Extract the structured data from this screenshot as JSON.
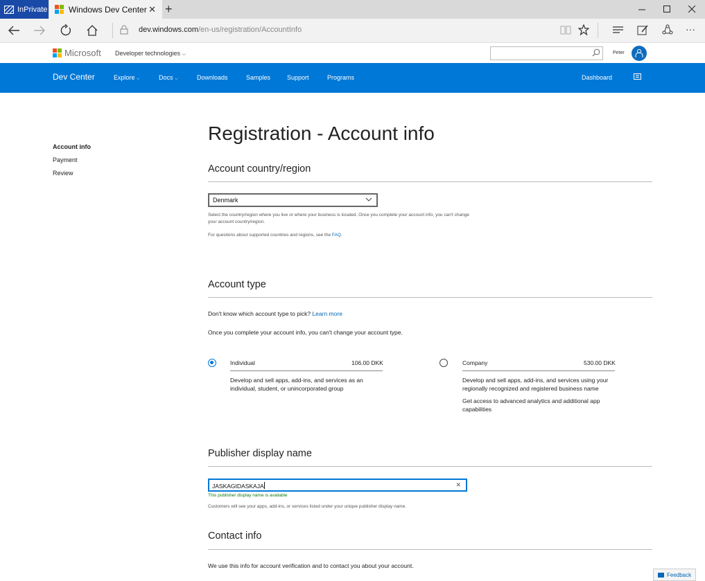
{
  "browser": {
    "inprivate_label": "InPrivate",
    "tab_title": "Windows Dev Center",
    "url_host": "dev.windows.com",
    "url_path": "/en-us/registration/AccountInfo"
  },
  "ms_header": {
    "logo_text": "Microsoft",
    "dev_tech": "Developer technologies",
    "search_value": "",
    "user_name": "Peter"
  },
  "nav": {
    "brand": "Dev Center",
    "items": [
      "Explore",
      "Docs",
      "Downloads",
      "Samples",
      "Support",
      "Programs"
    ],
    "dashboard": "Dashboard"
  },
  "side_nav": [
    "Account info",
    "Payment",
    "Review"
  ],
  "page": {
    "title": "Registration - Account info",
    "country": {
      "heading": "Account country/region",
      "selected": "Denmark",
      "help1": "Select the country/region where you live or where your business is located. Once you complete your account info, you can't change",
      "help2": "your account country/region.",
      "faq_prefix": "For questions about supported countries and regions, see the ",
      "faq_link": "FAQ",
      "faq_suffix": "."
    },
    "account_type": {
      "heading": "Account type",
      "question": "Don't know which account type to pick? ",
      "learn_more": "Learn more",
      "note": "Once you complete your account info, you can't change your account type.",
      "individual": {
        "label": "Individual",
        "price": "106.00 DKK",
        "desc1": "Develop and sell apps, add-ins, and services as an",
        "desc2": "individual, student, or unincorporated group",
        "selected": true
      },
      "company": {
        "label": "Company",
        "price": "530.00 DKK",
        "desc1": "Develop and sell apps, add-ins, and services using your",
        "desc2": "regionally recognized and registered business name",
        "desc3": "Get access to advanced analytics and additional app",
        "desc4": "capabilities",
        "selected": false
      }
    },
    "publisher": {
      "heading": "Publisher display name",
      "value": "JASKAGIDASKAJA",
      "available": "This publisher display name is available",
      "help": "Customers will see your apps, add-ins, or services listed under your unique publisher display name."
    },
    "contact": {
      "heading": "Contact info",
      "text": "We use this info for account verification and to contact you about your account."
    }
  },
  "feedback_label": "Feedback",
  "colors": {
    "accent": "#0078d7",
    "link": "#0067b8",
    "success": "#107c10",
    "inprivate": "#1a4aa7"
  }
}
